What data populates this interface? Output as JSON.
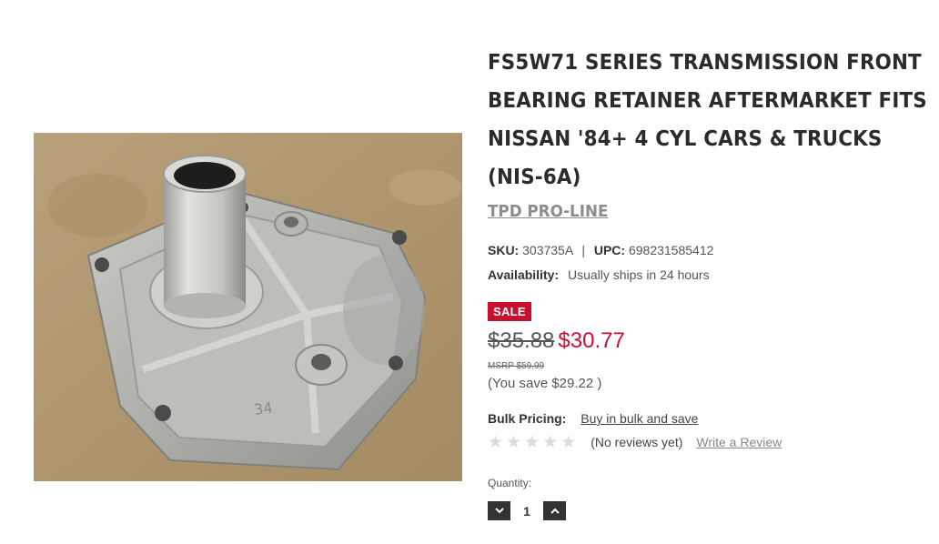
{
  "product": {
    "title": "FS5W71 SERIES TRANSMISSION FRONT BEARING RETAINER AFTERMARKET FITS NISSAN '84+ 4 CYL CARS & TRUCKS (NIS-6A)",
    "brand": "TPD PRO-LINE",
    "image_alt": "Transmission front bearing retainer",
    "image_stamp": "34"
  },
  "sku": {
    "label": "SKU:",
    "value": "303735A"
  },
  "upc": {
    "label": "UPC:",
    "value": "698231585412"
  },
  "separator": "|",
  "availability": {
    "label": "Availability:",
    "value": "Usually ships in 24 hours"
  },
  "sale_badge": "SALE",
  "price": {
    "old": "$35.88",
    "new": "$30.77",
    "msrp": "MSRP $59.99",
    "you_save": "(You save $29.22 )"
  },
  "bulk_pricing": {
    "label": "Bulk Pricing:",
    "link": "Buy in bulk and save"
  },
  "reviews": {
    "rating": 0,
    "max_rating": 5,
    "count_text": "(No reviews yet)",
    "write_review": "Write a Review"
  },
  "quantity": {
    "label": "Quantity:",
    "value": "1"
  },
  "colors": {
    "sale_red": "#c8102e",
    "title_dark": "#2b2b2b",
    "brand_grey": "#8c8c8c",
    "button_dark": "#333333"
  },
  "icons": {
    "decrement": "chevron-down-icon",
    "increment": "chevron-up-icon",
    "star": "star-icon"
  }
}
